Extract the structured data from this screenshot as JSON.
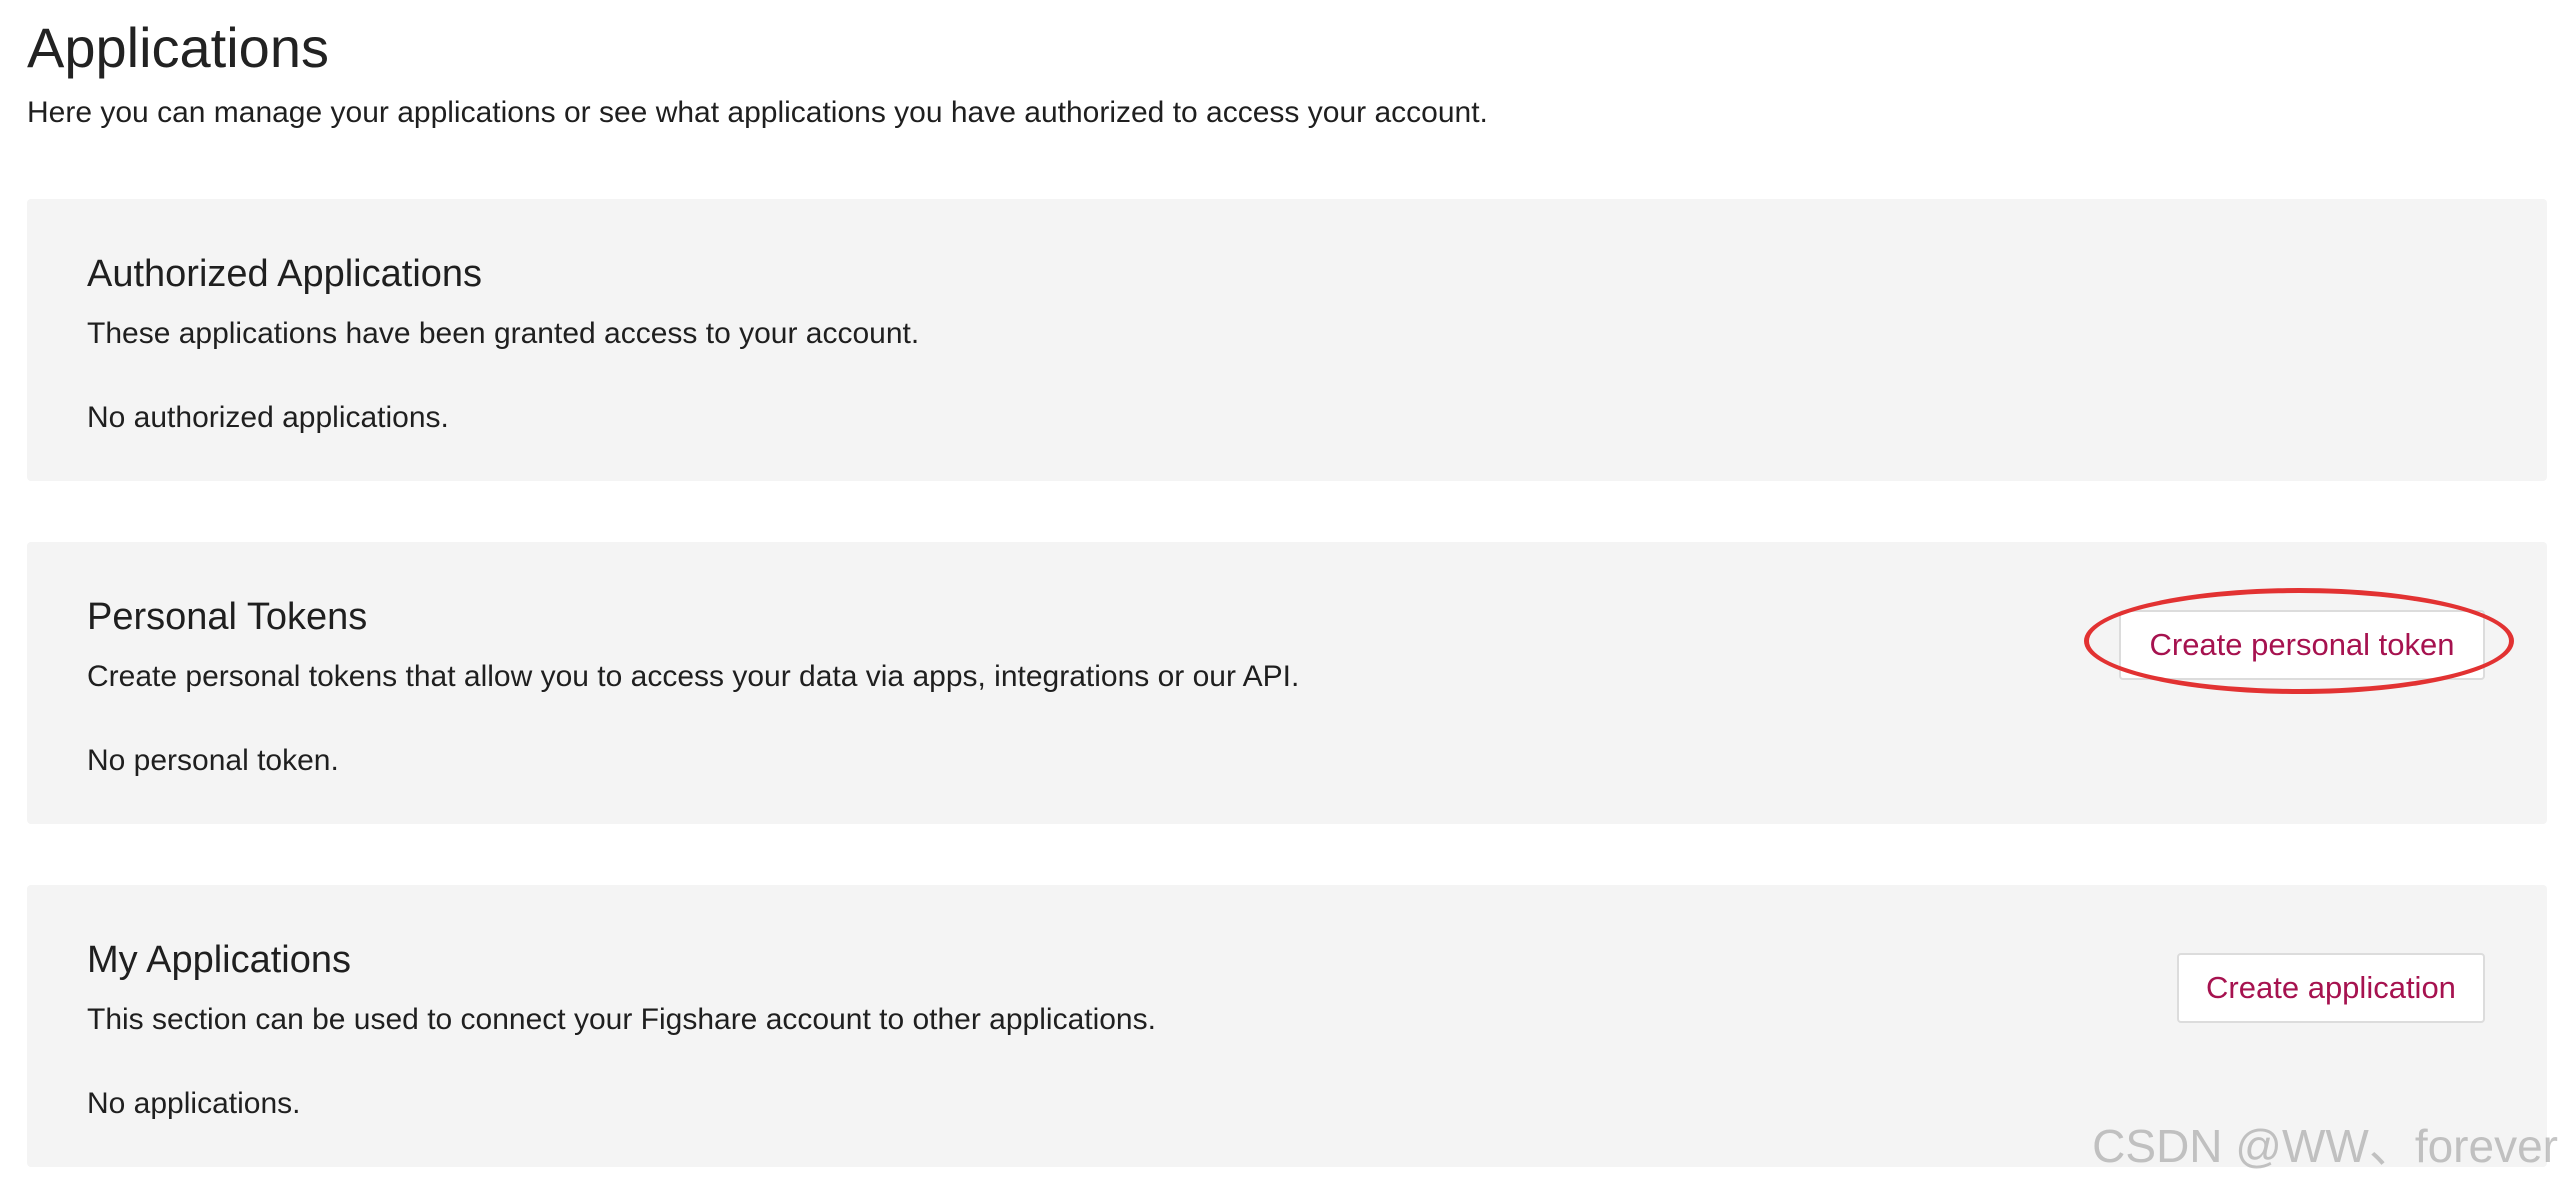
{
  "header": {
    "title": "Applications",
    "subtitle": "Here you can manage your applications or see what applications you have authorized to access your account."
  },
  "sections": [
    {
      "title": "Authorized Applications",
      "description": "These applications have been granted access to your account.",
      "empty_text": "No authorized applications."
    },
    {
      "title": "Personal Tokens",
      "description": "Create personal tokens that allow you to access your data via apps, integrations or our API.",
      "empty_text": "No personal token.",
      "button_label": "Create personal token"
    },
    {
      "title": "My Applications",
      "description": "This section can be used to connect your Figshare account to other applications.",
      "empty_text": "No applications.",
      "button_label": "Create application"
    }
  ],
  "watermark": "CSDN @WW、forever",
  "colors": {
    "accent": "#a6124f",
    "panel_background": "#f4f4f4",
    "highlight": "#e23232"
  }
}
